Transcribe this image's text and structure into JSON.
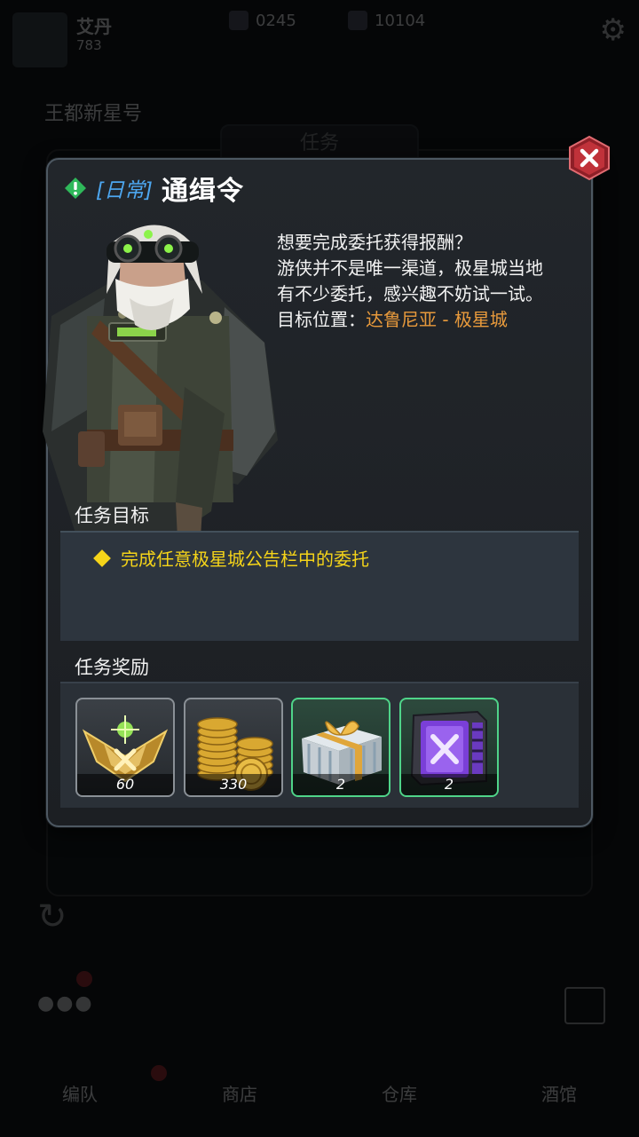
{
  "background": {
    "player_name": "艾丹",
    "player_level": "783",
    "resources": [
      {
        "icon": "energy-icon",
        "value": "0245"
      },
      {
        "icon": "crystal-icon",
        "value": "10104"
      }
    ],
    "location": "王都新星号",
    "panel_title": "任务",
    "nav_items": [
      "编队",
      "商店",
      "仓库",
      "酒馆"
    ]
  },
  "quest": {
    "type": "[日常]",
    "title": "通缉令",
    "description_lines": [
      "想要完成委托获得报酬？",
      "游侠并不是唯一渠道，极星城当地",
      "有不少委托，感兴趣不妨试一试。"
    ],
    "location_label": "目标位置：",
    "location_value": "达鲁尼亚 - 极星城",
    "objective_heading": "任务目标",
    "objectives": [
      "完成任意极星城公告栏中的委托"
    ],
    "reward_heading": "任务奖励",
    "rewards": [
      {
        "icon": "rank-badge-icon",
        "count": "60",
        "rarity": "common"
      },
      {
        "icon": "gold-coins-icon",
        "count": "330",
        "rarity": "common"
      },
      {
        "icon": "gift-box-icon",
        "count": "2",
        "rarity": "uncommon"
      },
      {
        "icon": "purple-crate-icon",
        "count": "2",
        "rarity": "uncommon"
      }
    ]
  },
  "colors": {
    "quest_type": "#4da7f0",
    "location_value": "#e89a3c",
    "objective_text": "#f5d419",
    "uncommon_border": "#4fd489",
    "close_button": "#c0323a"
  }
}
